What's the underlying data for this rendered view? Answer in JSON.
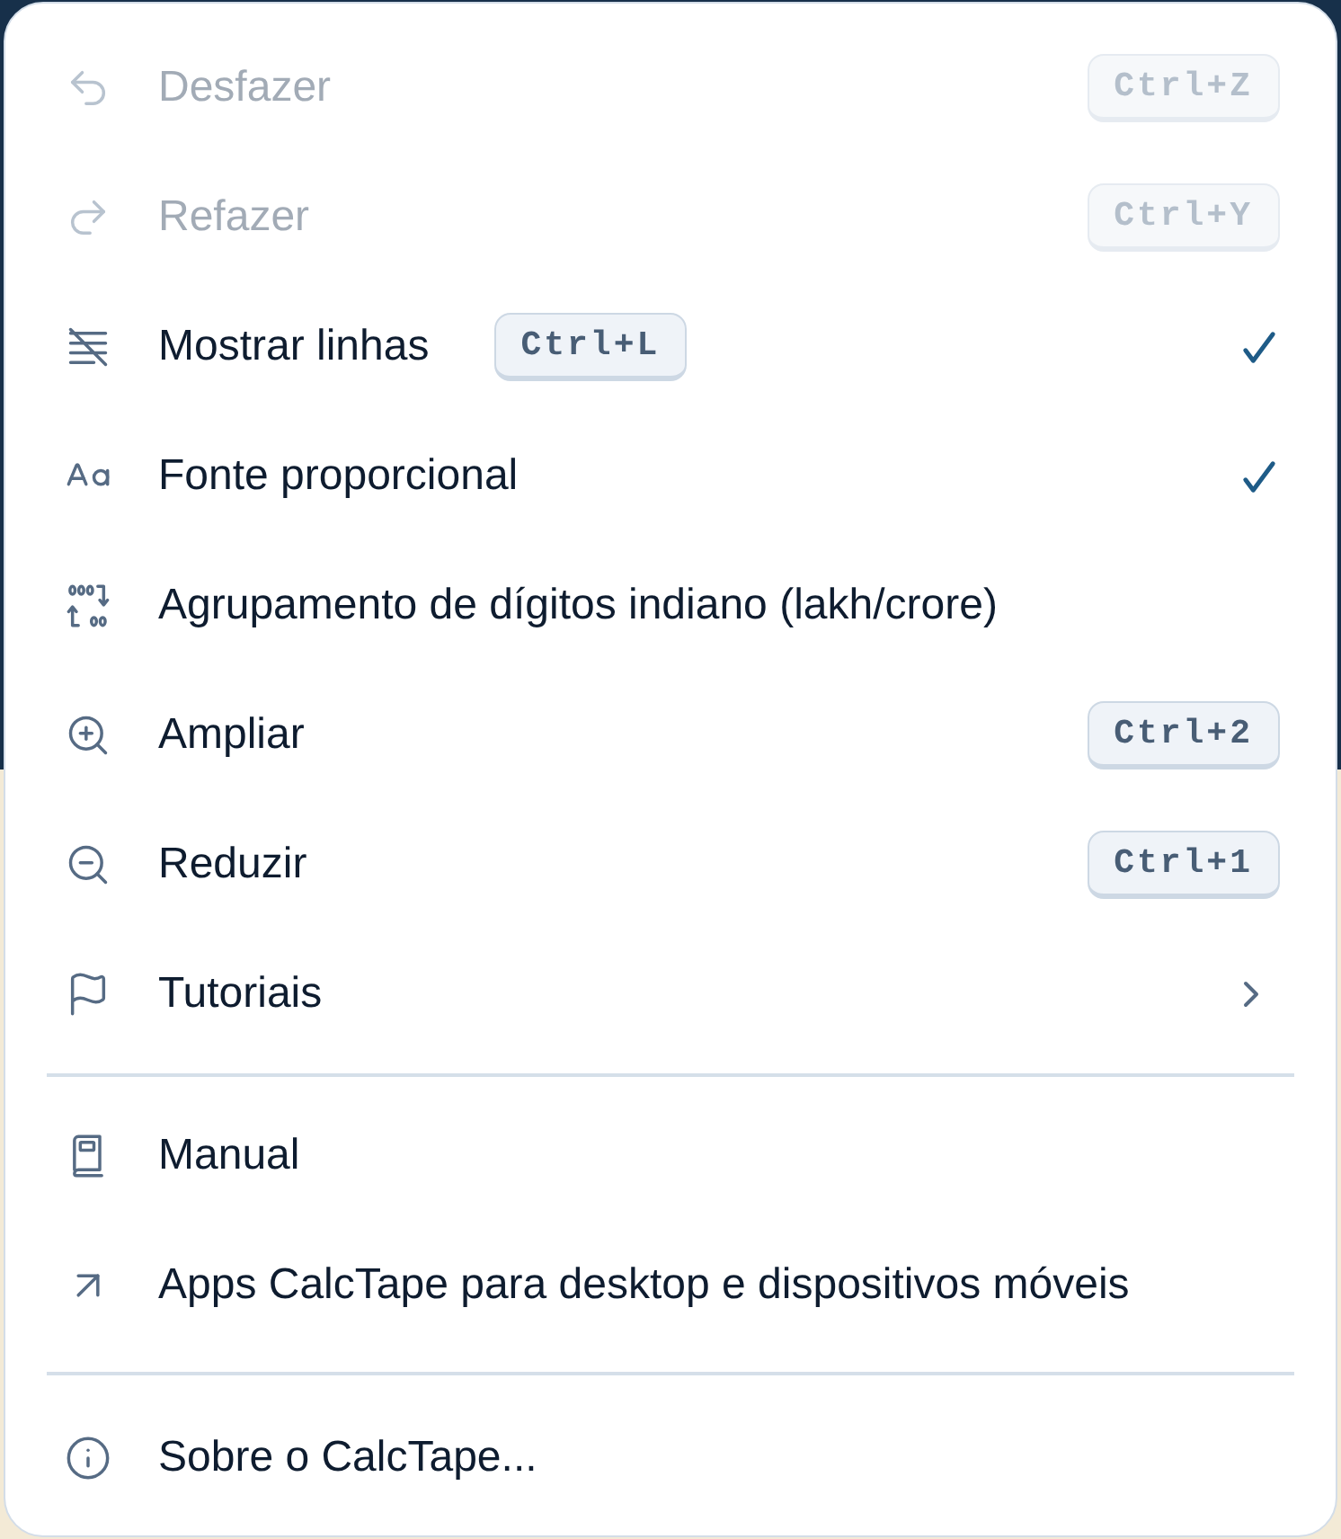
{
  "menu": {
    "sections": [
      {
        "items": [
          {
            "kind": "action",
            "label": "Desfazer",
            "shortcut": "Ctrl+Z",
            "disabled": true
          },
          {
            "kind": "action",
            "label": "Refazer",
            "shortcut": "Ctrl+Y",
            "disabled": true
          },
          {
            "kind": "toggle",
            "label": "Mostrar linhas",
            "shortcut": "Ctrl+L",
            "disabled": false,
            "checked": true
          },
          {
            "kind": "toggle",
            "label": "Fonte proporcional",
            "disabled": false,
            "checked": true
          },
          {
            "kind": "toggle",
            "label": "Agrupamento de dígitos indiano (lakh/crore)",
            "disabled": false,
            "checked": false
          },
          {
            "kind": "action",
            "label": "Ampliar",
            "shortcut": "Ctrl+2",
            "disabled": false
          },
          {
            "kind": "action",
            "label": "Reduzir",
            "shortcut": "Ctrl+1",
            "disabled": false
          },
          {
            "kind": "submenu",
            "label": "Tutoriais",
            "disabled": false
          }
        ]
      },
      {
        "items": [
          {
            "kind": "action",
            "label": "Manual",
            "disabled": false
          },
          {
            "kind": "action",
            "label": "Apps CalcTape para desktop e dispositivos móveis",
            "disabled": false
          }
        ]
      },
      {
        "items": [
          {
            "kind": "action",
            "label": "Sobre o CalcTape...",
            "disabled": false
          }
        ]
      }
    ]
  }
}
